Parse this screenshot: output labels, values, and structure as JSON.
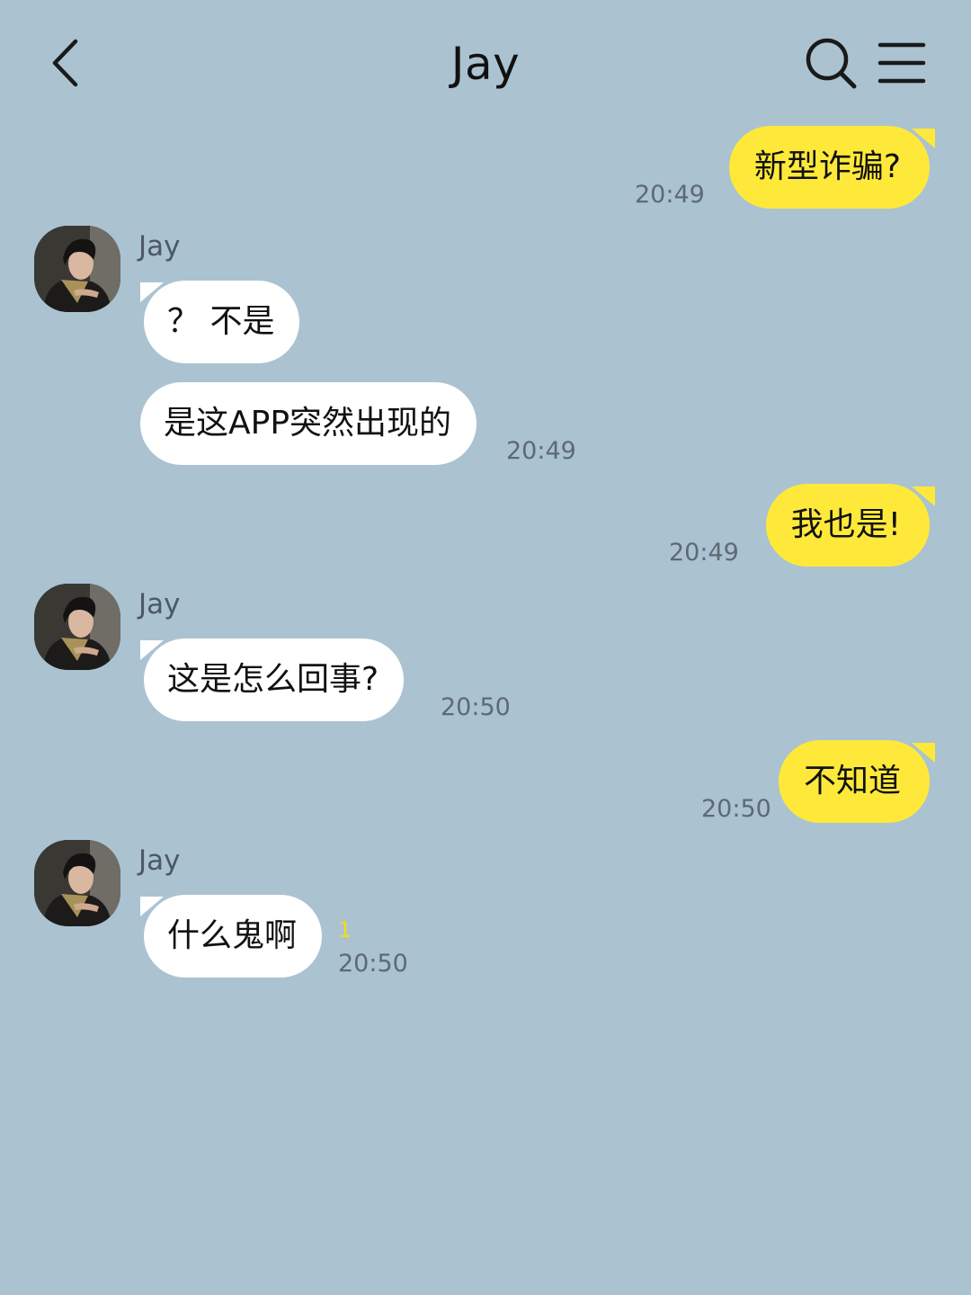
{
  "header": {
    "title": "Jay",
    "back_icon": "chevron-left-icon",
    "search_icon": "search-icon",
    "menu_icon": "hamburger-menu-icon"
  },
  "colors": {
    "background": "#abc2d1",
    "my_bubble": "#fee93a",
    "their_bubble": "#ffffff",
    "unread": "#f3da1b"
  },
  "messages": [
    {
      "sender": "me",
      "text": "新型诈骗?",
      "time": "20:49"
    },
    {
      "sender": "Jay",
      "text": "？ 不是",
      "time": ""
    },
    {
      "sender": "Jay",
      "text": "是这APP突然出现的",
      "time": "20:49"
    },
    {
      "sender": "me",
      "text": "我也是!",
      "time": "20:49"
    },
    {
      "sender": "Jay",
      "text": "这是怎么回事?",
      "time": "20:50"
    },
    {
      "sender": "me",
      "text": "不知道",
      "time": "20:50"
    },
    {
      "sender": "Jay",
      "text": "什么鬼啊",
      "time": "20:50",
      "unread": "1"
    }
  ],
  "contact": {
    "name": "Jay"
  }
}
